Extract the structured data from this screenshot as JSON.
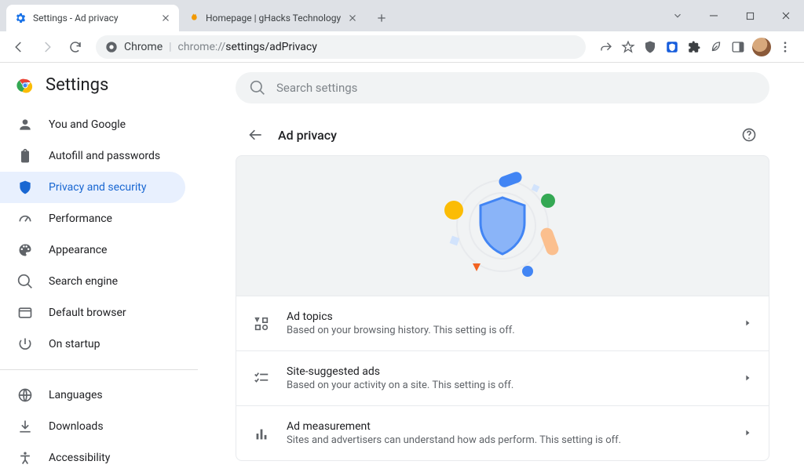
{
  "tabs": [
    {
      "title": "Settings - Ad privacy"
    },
    {
      "title": "Homepage | gHacks Technology"
    }
  ],
  "omnibox": {
    "prefix": "Chrome",
    "sep": "|",
    "url_dim": "chrome://",
    "url_path": "settings/adPrivacy"
  },
  "brand": "Settings",
  "search_placeholder": "Search settings",
  "sidebar": {
    "items": [
      {
        "label": "You and Google"
      },
      {
        "label": "Autofill and passwords"
      },
      {
        "label": "Privacy and security"
      },
      {
        "label": "Performance"
      },
      {
        "label": "Appearance"
      },
      {
        "label": "Search engine"
      },
      {
        "label": "Default browser"
      },
      {
        "label": "On startup"
      }
    ],
    "items2": [
      {
        "label": "Languages"
      },
      {
        "label": "Downloads"
      },
      {
        "label": "Accessibility"
      }
    ]
  },
  "page": {
    "title": "Ad privacy",
    "rows": [
      {
        "title": "Ad topics",
        "desc": "Based on your browsing history. This setting is off."
      },
      {
        "title": "Site-suggested ads",
        "desc": "Based on your activity on a site. This setting is off."
      },
      {
        "title": "Ad measurement",
        "desc": "Sites and advertisers can understand how ads perform. This setting is off."
      }
    ]
  }
}
